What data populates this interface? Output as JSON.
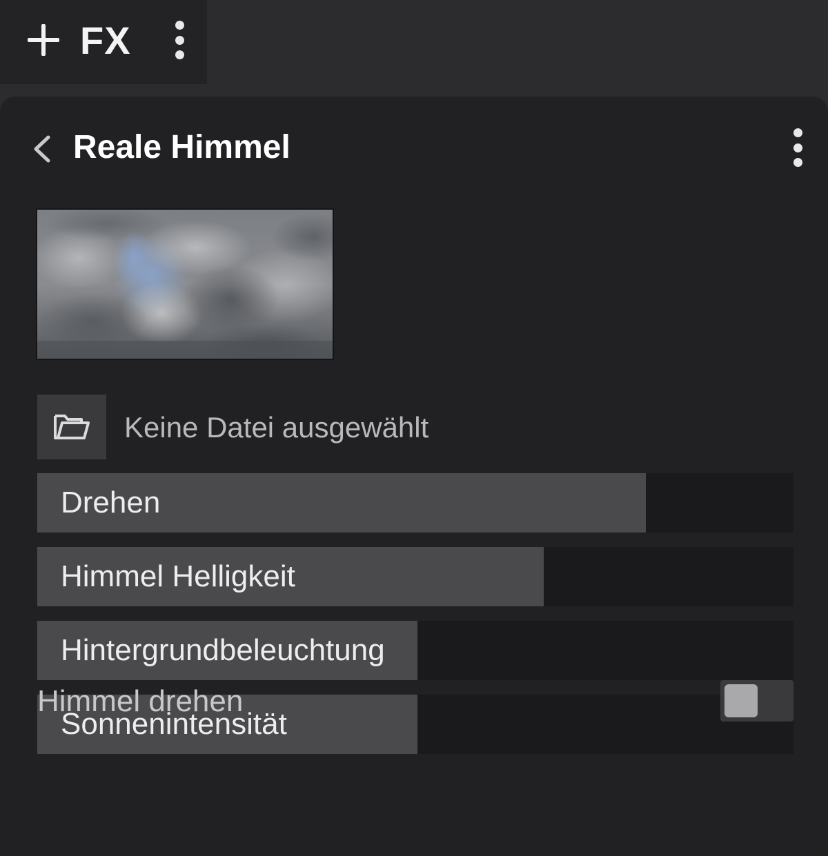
{
  "toolbar": {
    "add_fx_label": "FX",
    "icons": [
      "plus-icon",
      "kebab-menu-icon"
    ]
  },
  "panel": {
    "title": "Reale Himmel",
    "icons": [
      "chevron-left-icon",
      "kebab-menu-icon",
      "folder-open-icon"
    ],
    "file": {
      "status": "Keine Datei ausgewählt"
    },
    "sliders": [
      {
        "label": "Drehen",
        "value": 0.805
      },
      {
        "label": "Himmel Helligkeit",
        "value": 0.67
      },
      {
        "label": "Hintergrundbeleuchtung",
        "value": 0.503
      },
      {
        "label": "Sonnenintensität",
        "value": 0.503
      }
    ],
    "toggle": {
      "label": "Himmel drehen",
      "on": false
    }
  },
  "colors": {
    "background": "#2c2c2f",
    "panel": "#212124",
    "slider_track": "#1a1a1c",
    "slider_fill": "#4a4a4d",
    "text": "#ededee"
  }
}
